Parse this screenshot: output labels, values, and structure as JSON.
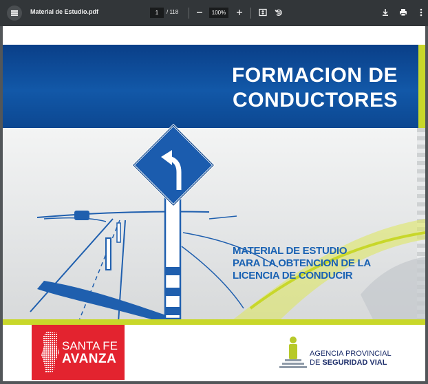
{
  "toolbar": {
    "file_name": "Material de Estudio.pdf",
    "page_current": "1",
    "page_total": "/ 118",
    "zoom": "100%",
    "zoom_out_icon": "minus-icon",
    "zoom_in_icon": "plus-icon",
    "fit_icon": "fit-page-icon",
    "rotate_icon": "rotate-icon",
    "download_icon": "download-icon",
    "print_icon": "print-icon",
    "more_icon": "more-vert-icon"
  },
  "cover": {
    "title_line1": "FORMACION DE",
    "title_line2": "CONDUCTORES",
    "subtitle_line1": "MATERIAL DE ESTUDIO",
    "subtitle_line2": "PARA LA OBTENCION DE LA",
    "subtitle_line3": "LICENCIA DE CONDUCIR",
    "left_logo_line1": "SANTA FE",
    "left_logo_line2": "AVANZA",
    "right_logo_line1": "AGENCIA PROVINCIAL",
    "right_logo_line2_prefix": "DE ",
    "right_logo_line2_bold": "SEGURIDAD VIAL"
  },
  "colors": {
    "toolbar_bg": "#323639",
    "band_blue": "#1258a8",
    "accent_green": "#c8d72a",
    "subtitle_blue": "#1a62b3",
    "logo_red": "#e3232f",
    "logo_navy": "#1d2e6b"
  }
}
